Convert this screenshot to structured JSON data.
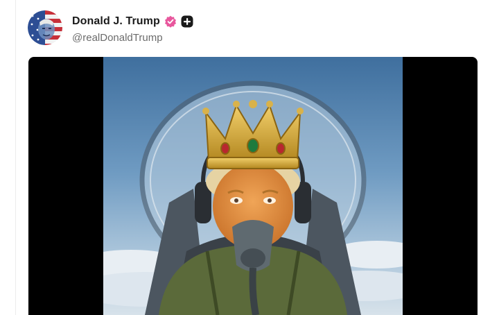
{
  "post": {
    "author": {
      "display_name": "Donald J. Trump",
      "handle": "@realDonaldTrump",
      "verified": true
    },
    "media": {
      "type": "video",
      "subject": "illustration"
    }
  },
  "colors": {
    "verified_badge": "#e8579d",
    "plus_badge": "#1a1a1a",
    "media_background": "#000000"
  },
  "icons": {
    "verified": "verified-badge-icon",
    "plus": "plus-badge-icon"
  }
}
